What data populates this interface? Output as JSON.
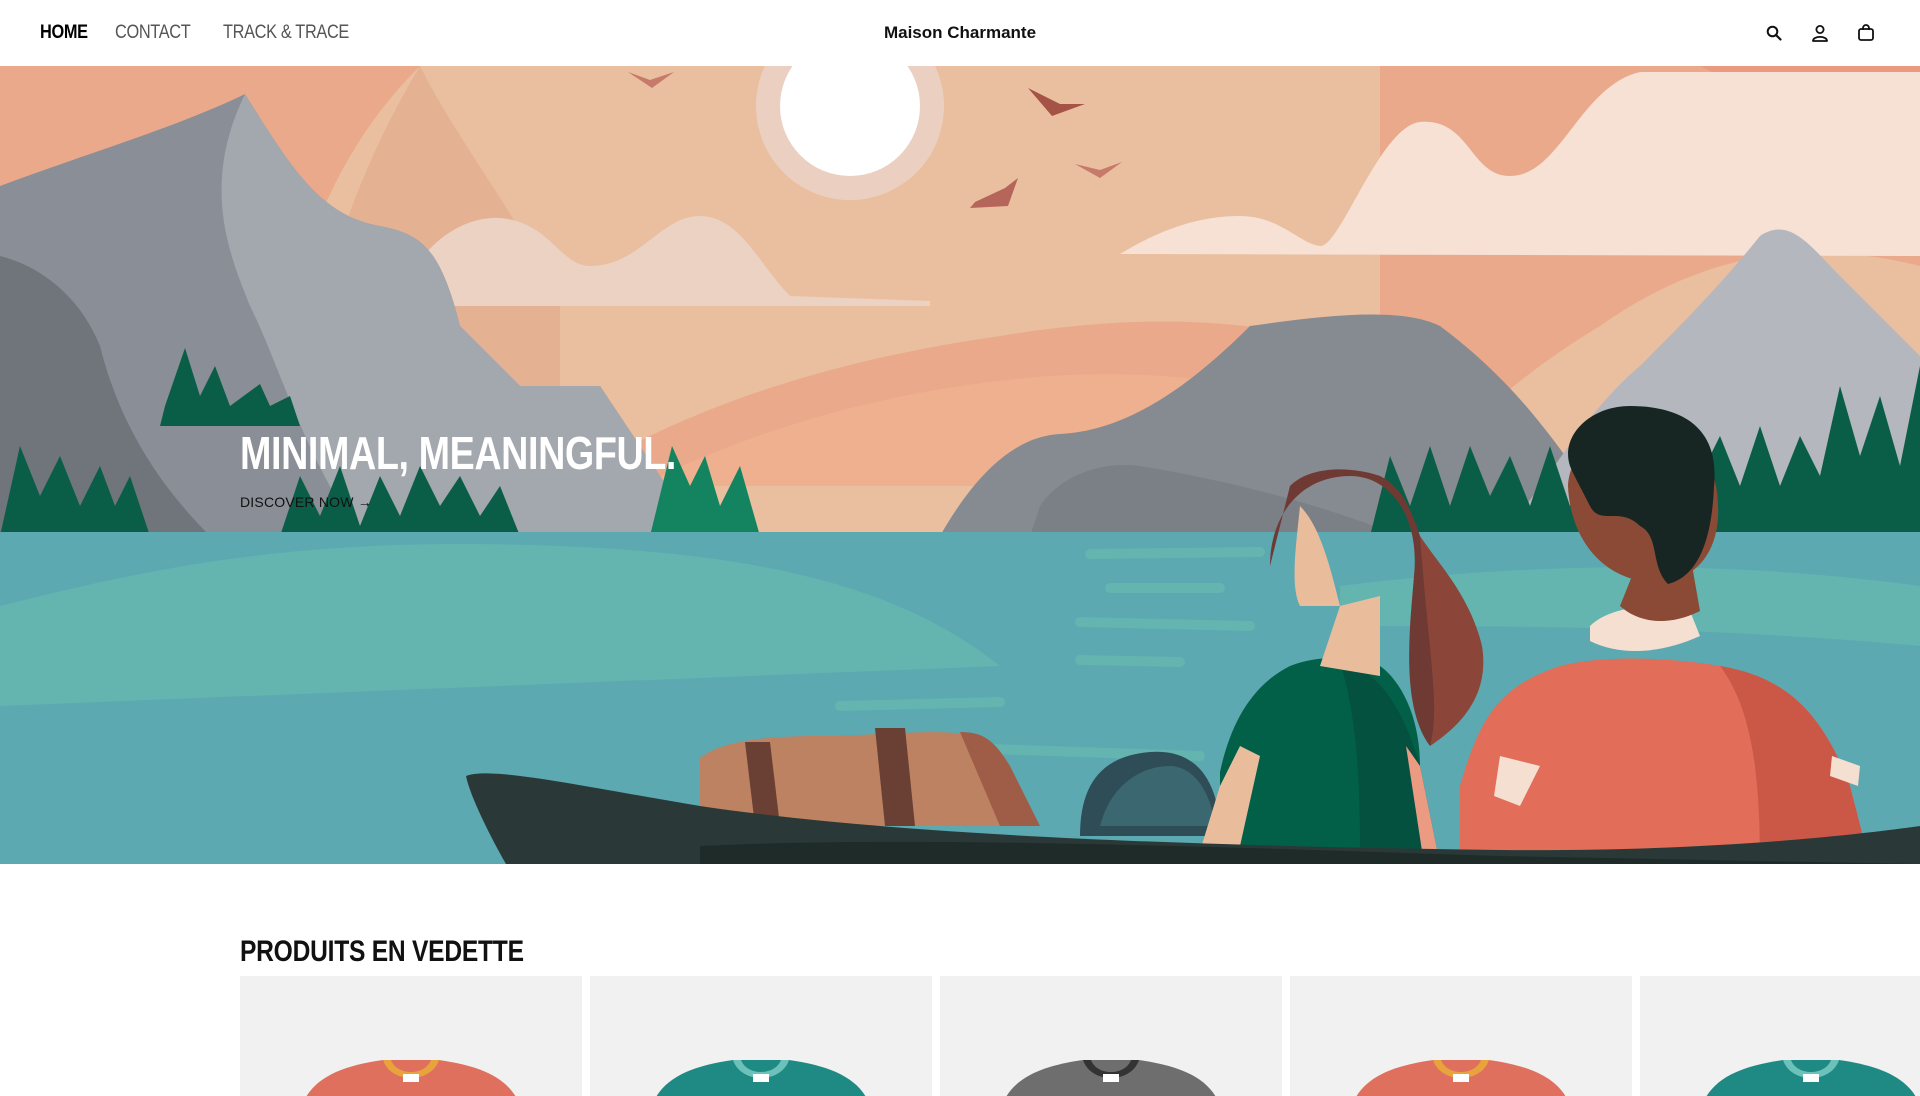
{
  "header": {
    "nav": [
      {
        "label": "HOME",
        "active": true
      },
      {
        "label": "CONTACT",
        "active": false
      },
      {
        "label": "TRACK & TRACE",
        "active": false
      }
    ],
    "brand": "Maison Charmante",
    "icons": [
      "search-icon",
      "account-icon",
      "cart-icon"
    ]
  },
  "hero": {
    "title": "MINIMAL, MEANINGFUL.",
    "cta": "DISCOVER NOW →"
  },
  "featured": {
    "title": "PRODUITS EN VEDETTE",
    "products": [
      {
        "color": "#e0705e",
        "collar": "#e8a33c"
      },
      {
        "color": "#1f8a84",
        "collar": "#6cc2bb"
      },
      {
        "color": "#6e6e6e",
        "collar": "#333333"
      },
      {
        "color": "#e0705e",
        "collar": "#e8a33c"
      },
      {
        "color": "#1f8a84",
        "collar": "#6cc2bb"
      }
    ]
  },
  "colors": {
    "sky": "#e9bf9f",
    "lake": "#5ca9b1",
    "tree": "#0a5e47",
    "mountain": "#9a9ea6"
  }
}
